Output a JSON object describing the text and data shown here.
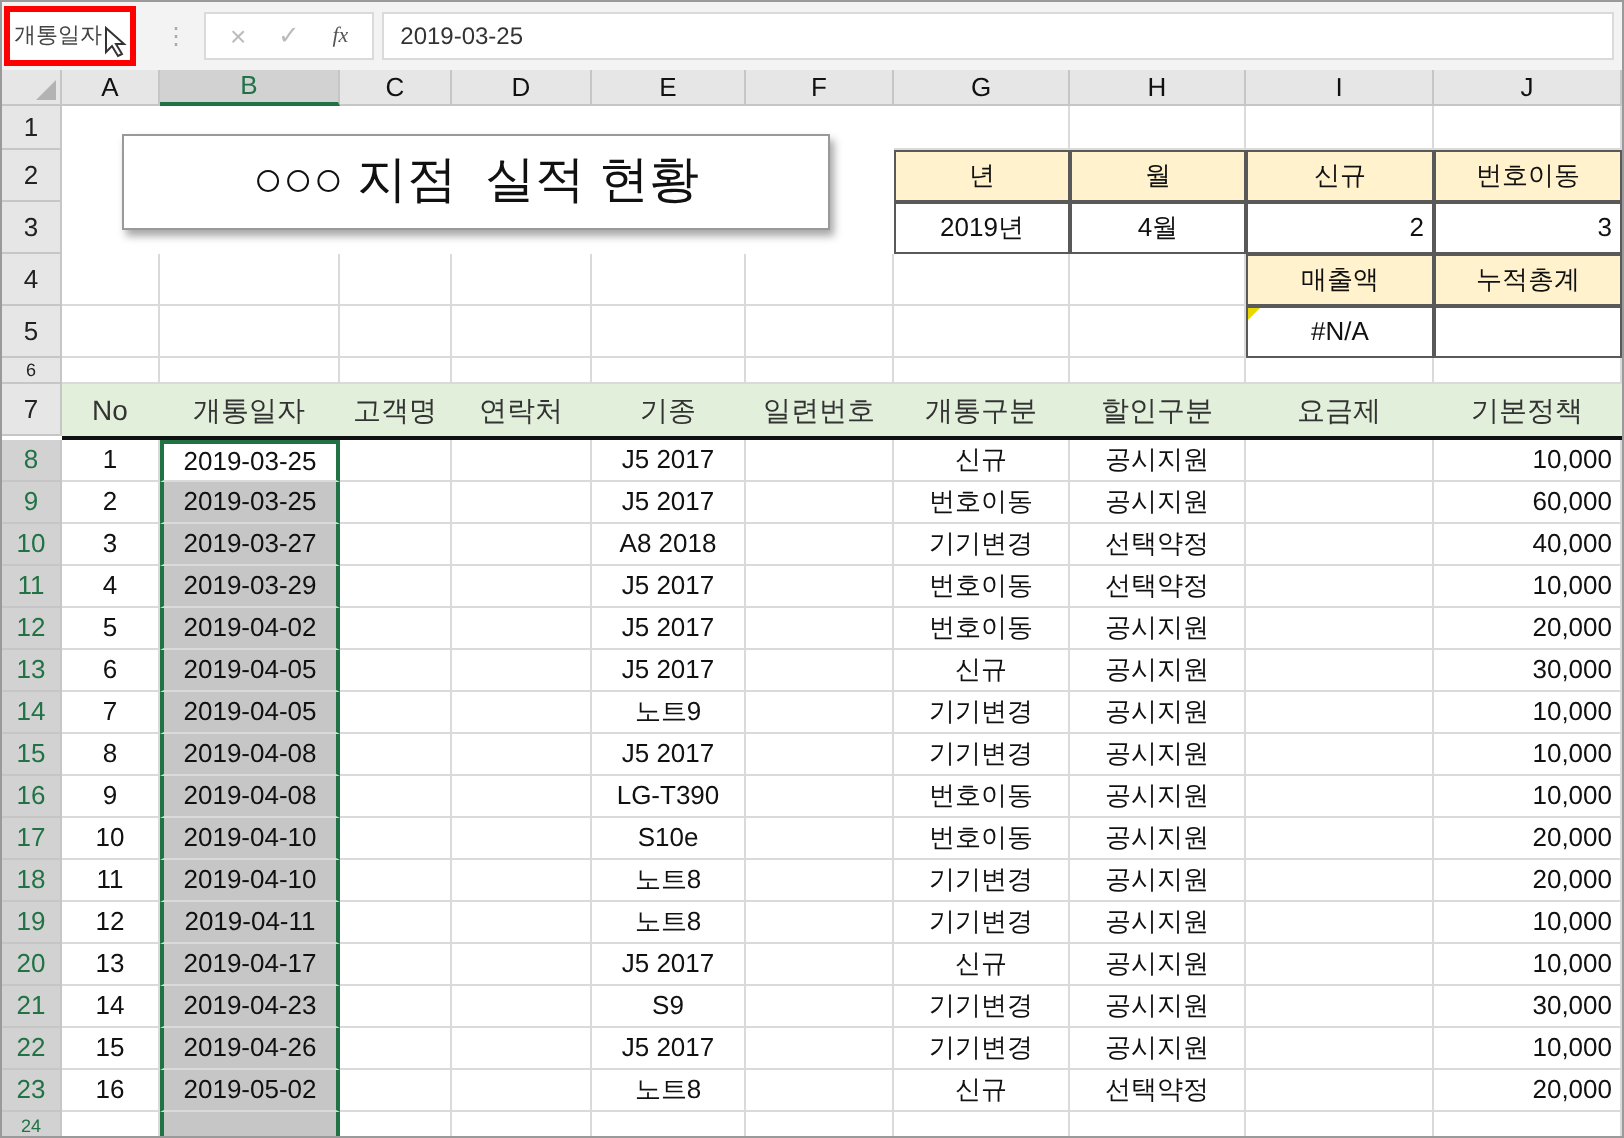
{
  "name_box": {
    "value": "개통일자",
    "highlighted": true
  },
  "formula_bar": {
    "separator": "⋮",
    "cancel": "×",
    "enter": "✓",
    "function": "fx",
    "value": "2019-03-25"
  },
  "columns": [
    {
      "label": "A",
      "selected": false
    },
    {
      "label": "B",
      "selected": true
    },
    {
      "label": "C",
      "selected": false
    },
    {
      "label": "D",
      "selected": false
    },
    {
      "label": "E",
      "selected": false
    },
    {
      "label": "F",
      "selected": false
    },
    {
      "label": "G",
      "selected": false
    },
    {
      "label": "H",
      "selected": false
    },
    {
      "label": "I",
      "selected": false
    },
    {
      "label": "J",
      "selected": false
    }
  ],
  "row_headers": [
    {
      "label": "1",
      "selected": false
    },
    {
      "label": "2",
      "selected": false
    },
    {
      "label": "3",
      "selected": false
    },
    {
      "label": "4",
      "selected": false
    },
    {
      "label": "5",
      "selected": false
    },
    {
      "label": "6",
      "selected": false
    },
    {
      "label": "7",
      "selected": false
    },
    {
      "label": "8",
      "selected": true
    },
    {
      "label": "9",
      "selected": true
    },
    {
      "label": "10",
      "selected": true
    },
    {
      "label": "11",
      "selected": true
    },
    {
      "label": "12",
      "selected": true
    },
    {
      "label": "13",
      "selected": true
    },
    {
      "label": "14",
      "selected": true
    },
    {
      "label": "15",
      "selected": true
    },
    {
      "label": "16",
      "selected": true
    },
    {
      "label": "17",
      "selected": true
    },
    {
      "label": "18",
      "selected": true
    },
    {
      "label": "19",
      "selected": true
    },
    {
      "label": "20",
      "selected": true
    },
    {
      "label": "21",
      "selected": true
    },
    {
      "label": "22",
      "selected": true
    },
    {
      "label": "23",
      "selected": true
    },
    {
      "label": "24",
      "selected": true
    }
  ],
  "title": "○○○ 지점  실적 현황",
  "summary": {
    "headers": [
      "년",
      "월",
      "신규",
      "번호이동"
    ],
    "values": [
      "2019년",
      "4월",
      "2",
      "3"
    ],
    "sales_headers": [
      "매출액",
      "누적총계"
    ],
    "sales_values": [
      {
        "text": "#N/A",
        "error_flag": true
      }
    ]
  },
  "table": {
    "columns": [
      "No",
      "개통일자",
      "고객명",
      "연락처",
      "기종",
      "일련번호",
      "개통구분",
      "할인구분",
      "요금제",
      "기본정책"
    ],
    "rows": [
      {
        "no": "1",
        "date": "2019-03-25",
        "model": "J5 2017",
        "activation": "신규",
        "discount": "공시지원",
        "policy": "10,000",
        "active": true
      },
      {
        "no": "2",
        "date": "2019-03-25",
        "model": "J5 2017",
        "activation": "번호이동",
        "discount": "공시지원",
        "policy": "60,000",
        "active": false
      },
      {
        "no": "3",
        "date": "2019-03-27",
        "model": "A8 2018",
        "activation": "기기변경",
        "discount": "선택약정",
        "policy": "40,000",
        "active": false
      },
      {
        "no": "4",
        "date": "2019-03-29",
        "model": "J5 2017",
        "activation": "번호이동",
        "discount": "선택약정",
        "policy": "10,000",
        "active": false
      },
      {
        "no": "5",
        "date": "2019-04-02",
        "model": "J5 2017",
        "activation": "번호이동",
        "discount": "공시지원",
        "policy": "20,000",
        "active": false
      },
      {
        "no": "6",
        "date": "2019-04-05",
        "model": "J5 2017",
        "activation": "신규",
        "discount": "공시지원",
        "policy": "30,000",
        "active": false
      },
      {
        "no": "7",
        "date": "2019-04-05",
        "model": "노트9",
        "activation": "기기변경",
        "discount": "공시지원",
        "policy": "10,000",
        "active": false
      },
      {
        "no": "8",
        "date": "2019-04-08",
        "model": "J5 2017",
        "activation": "기기변경",
        "discount": "공시지원",
        "policy": "10,000",
        "active": false
      },
      {
        "no": "9",
        "date": "2019-04-08",
        "model": "LG-T390",
        "activation": "번호이동",
        "discount": "공시지원",
        "policy": "10,000",
        "active": false
      },
      {
        "no": "10",
        "date": "2019-04-10",
        "model": "S10e",
        "activation": "번호이동",
        "discount": "공시지원",
        "policy": "20,000",
        "active": false
      },
      {
        "no": "11",
        "date": "2019-04-10",
        "model": "노트8",
        "activation": "기기변경",
        "discount": "공시지원",
        "policy": "20,000",
        "active": false
      },
      {
        "no": "12",
        "date": "2019-04-11",
        "model": "노트8",
        "activation": "기기변경",
        "discount": "공시지원",
        "policy": "10,000",
        "active": false
      },
      {
        "no": "13",
        "date": "2019-04-17",
        "model": "J5 2017",
        "activation": "신규",
        "discount": "공시지원",
        "policy": "10,000",
        "active": false
      },
      {
        "no": "14",
        "date": "2019-04-23",
        "model": "S9",
        "activation": "기기변경",
        "discount": "공시지원",
        "policy": "30,000",
        "active": false
      },
      {
        "no": "15",
        "date": "2019-04-26",
        "model": "J5 2017",
        "activation": "기기변경",
        "discount": "공시지원",
        "policy": "10,000",
        "active": false
      },
      {
        "no": "16",
        "date": "2019-05-02",
        "model": "노트8",
        "activation": "신규",
        "discount": "선택약정",
        "policy": "20,000",
        "active": false
      }
    ]
  }
}
